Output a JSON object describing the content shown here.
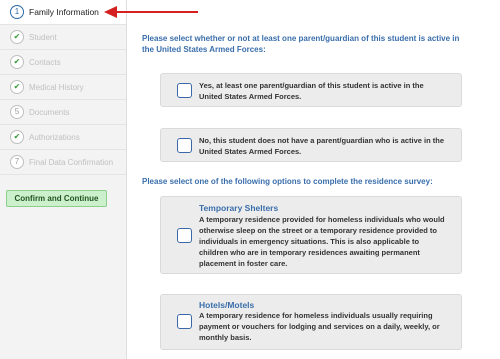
{
  "sidebar": {
    "steps": [
      {
        "number": "1",
        "label": "Family Information",
        "status": "active"
      },
      {
        "number": "✔",
        "label": "Student",
        "status": "complete"
      },
      {
        "number": "✔",
        "label": "Contacts",
        "status": "complete"
      },
      {
        "number": "✔",
        "label": "Medical History",
        "status": "complete"
      },
      {
        "number": "5",
        "label": "Documents",
        "status": "pending"
      },
      {
        "number": "✔",
        "label": "Authorizations",
        "status": "complete"
      },
      {
        "number": "7",
        "label": "Final Data Confirmation",
        "status": "pending"
      }
    ],
    "confirm_label": "Confirm and Continue"
  },
  "main": {
    "question1": "Please select whether or not at least one parent/guardian of this student is active in the United States Armed Forces:",
    "military_options": [
      {
        "text": "Yes, at least one parent/guardian of this student is active in the United States Armed Forces."
      },
      {
        "text": "No, this student does not have a parent/guardian who is active in the United States Armed Forces."
      }
    ],
    "question2": "Please select one of the following options to complete the residence survey:",
    "residence_options": [
      {
        "title": "Temporary Shelters",
        "text": "A temporary residence provided for homeless individuals who would otherwise sleep on the street or a temporary residence provided to individuals in emergency situations. This is also applicable to children who are in temporary residences awaiting permanent placement in foster care."
      },
      {
        "title": "Hotels/Motels",
        "text": "A temporary residence for homeless individuals usually requiring payment or vouchers for lodging and services on a daily, weekly, or monthly basis."
      }
    ]
  },
  "colors": {
    "accent_blue": "#3a6eab",
    "arrow_red": "#d42020",
    "confirm_green": "#ccf0cc"
  }
}
